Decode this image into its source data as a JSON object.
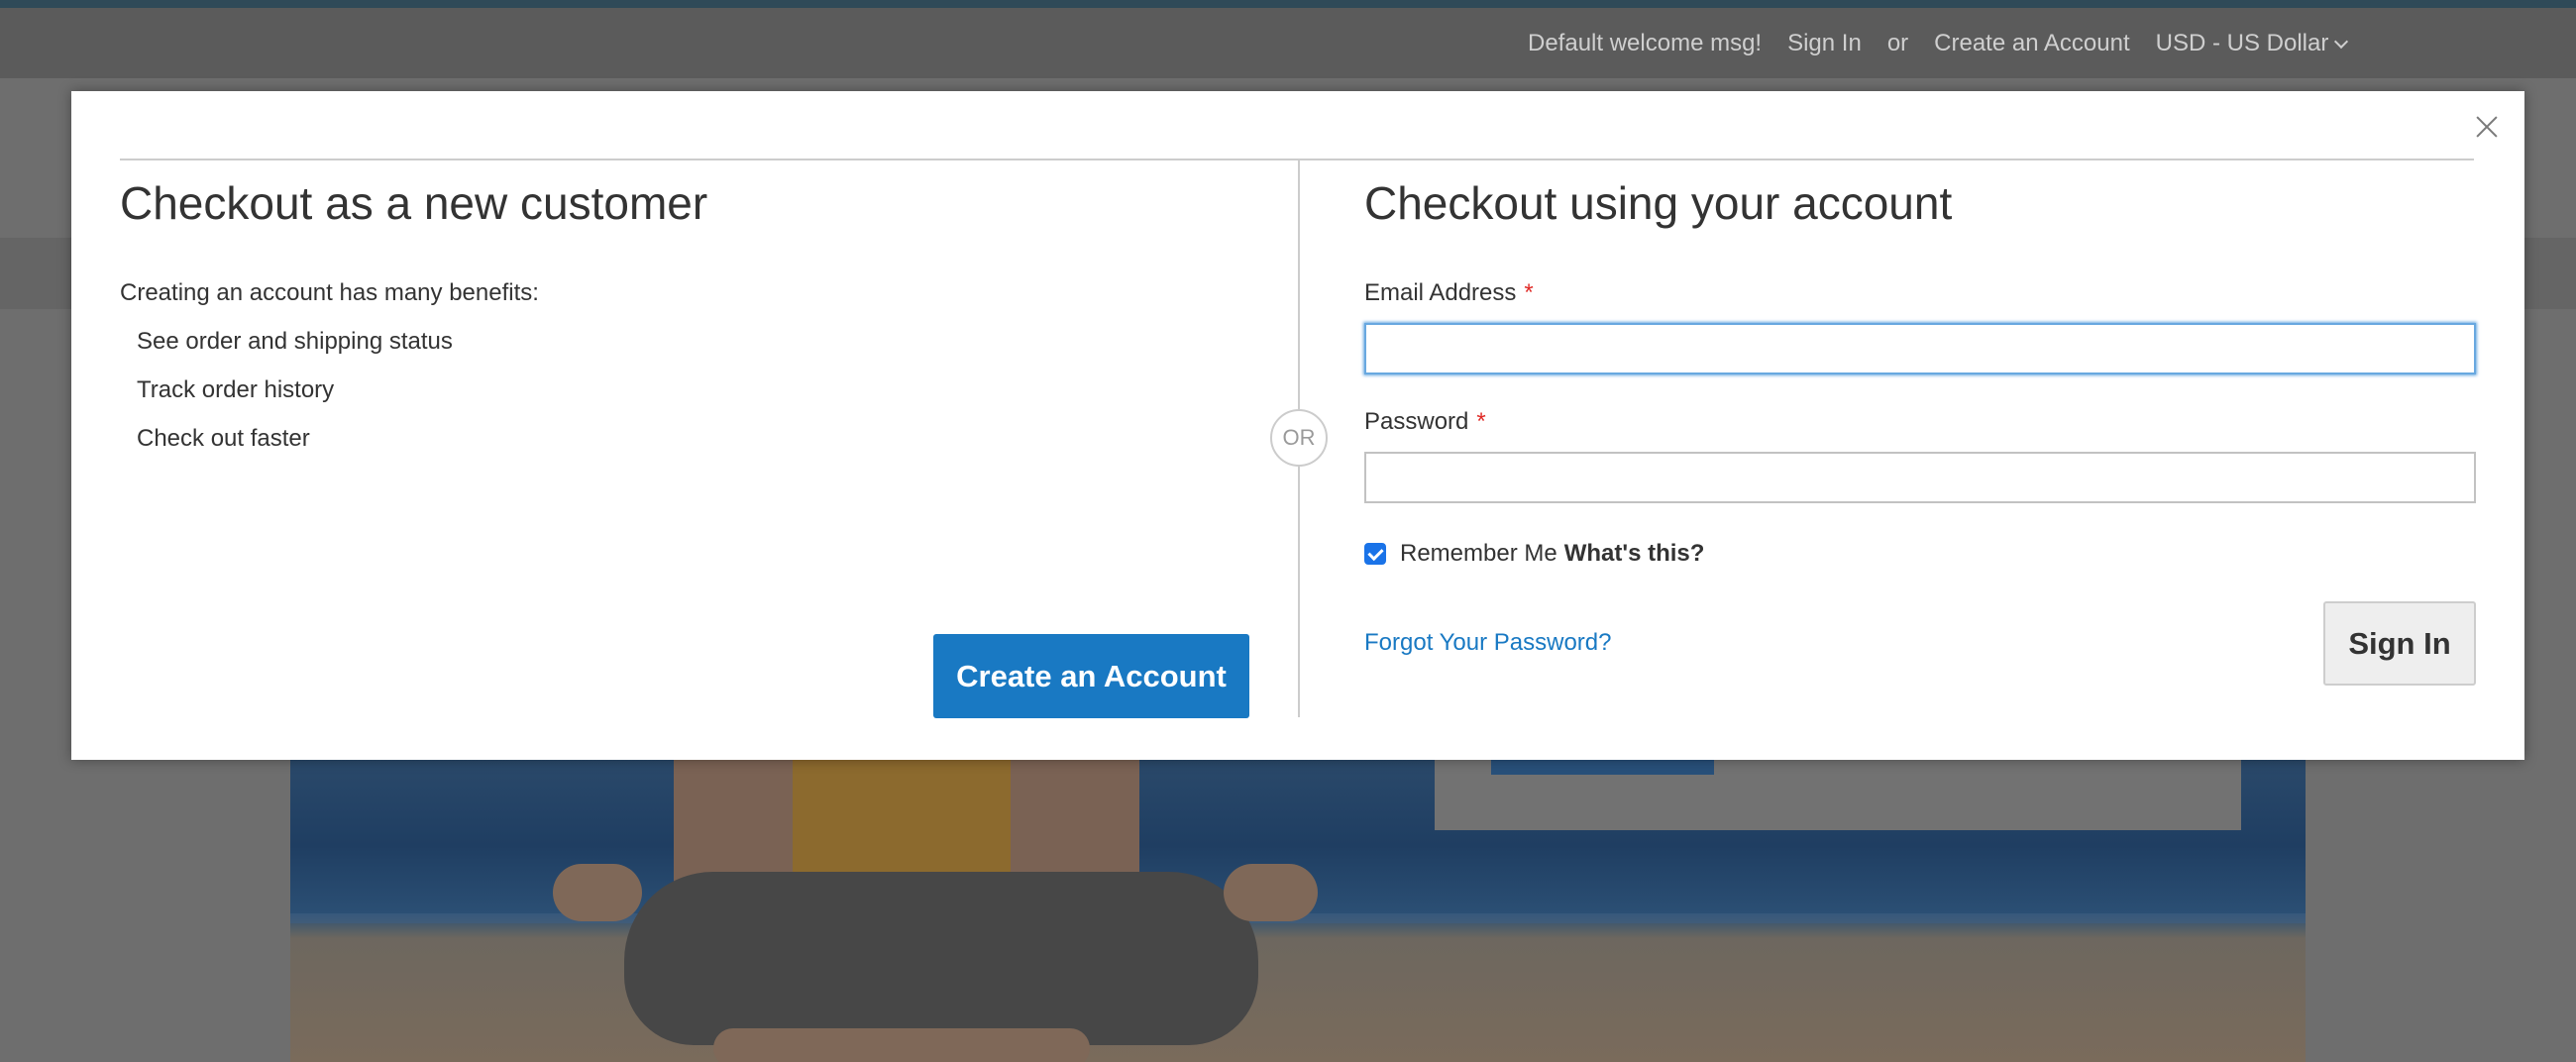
{
  "header": {
    "welcome": "Default welcome msg!",
    "sign_in": "Sign In",
    "or": "or",
    "create_account": "Create an Account",
    "currency": "USD - US Dollar"
  },
  "modal": {
    "left": {
      "title": "Checkout as a new customer",
      "intro": "Creating an account has many benefits:",
      "benefits": [
        "See order and shipping status",
        "Track order history",
        "Check out faster"
      ],
      "create_button": "Create an Account"
    },
    "or_label": "OR",
    "right": {
      "title": "Checkout using your account",
      "email_label": "Email Address",
      "email_value": "",
      "password_label": "Password",
      "password_value": "",
      "required_marker": "*",
      "remember_me": "Remember Me",
      "remember_checked": true,
      "whats_this": "What's this?",
      "forgot_password": "Forgot Your Password?",
      "sign_in_button": "Sign In"
    }
  },
  "colors": {
    "primary_button": "#1979c3",
    "link": "#1979c3",
    "required": "#e02b27",
    "focus_border": "#68a8e0"
  }
}
